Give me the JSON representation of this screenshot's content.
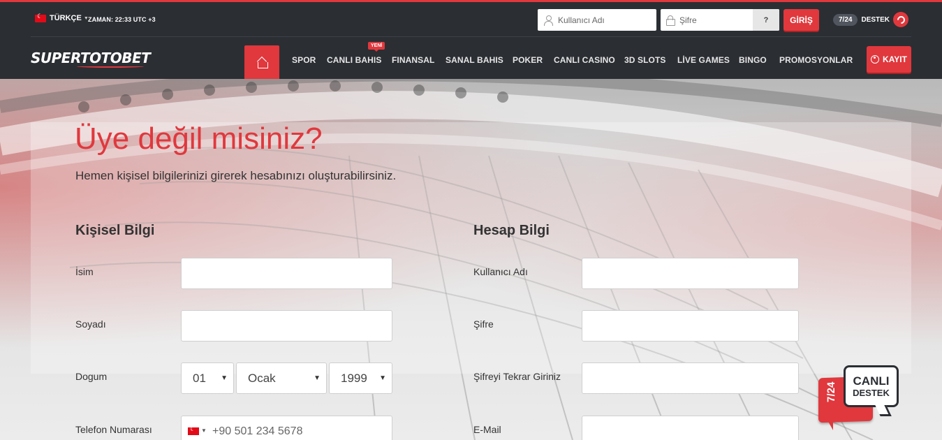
{
  "header": {
    "language": "TÜRKÇE",
    "time": "ZAMAN: 22:33 UTC +3",
    "username_placeholder": "Kullanıcı Adı",
    "password_placeholder": "Şifre",
    "forgot_label": "?",
    "login_label": "GİRİŞ",
    "support_hours": "7/24",
    "support_label": "DESTEK"
  },
  "nav": {
    "logo": "SUPERTOTOBET",
    "badge_new": "YENİ",
    "items": [
      "SPOR",
      "CANLI BAHIS",
      "FINANSAL",
      "SANAL BAHIS",
      "POKER",
      "CANLI CASINO",
      "3D SLOTS",
      "LİVE GAMES",
      "BINGO",
      "PROMOSYONLAR"
    ],
    "register_label": "KAYIT"
  },
  "hero": {
    "title": "Üye değil misiniz?",
    "subtitle": "Hemen kişisel bilgilerinizi girerek hesabınızı oluşturabilirsiniz."
  },
  "personal": {
    "title": "Kişisel Bilgi",
    "name_label": "İsim",
    "surname_label": "Soyadı",
    "birth_label": "Dogum",
    "birth_day": "01",
    "birth_month": "Ocak",
    "birth_year": "1999",
    "phone_label": "Telefon Numarası",
    "phone_placeholder": "+90 501 234 5678"
  },
  "account": {
    "title": "Hesap Bilgi",
    "username_label": "Kullanıcı Adı",
    "password_label": "Şifre",
    "password_repeat_label": "Şifreyi Tekrar Giriniz",
    "email_label": "E-Mail"
  },
  "live_support": {
    "hours": "7/24",
    "line1": "CANLI",
    "line2": "DESTEK"
  },
  "colors": {
    "accent": "#e0383d",
    "header_bg": "#2b2e33"
  }
}
